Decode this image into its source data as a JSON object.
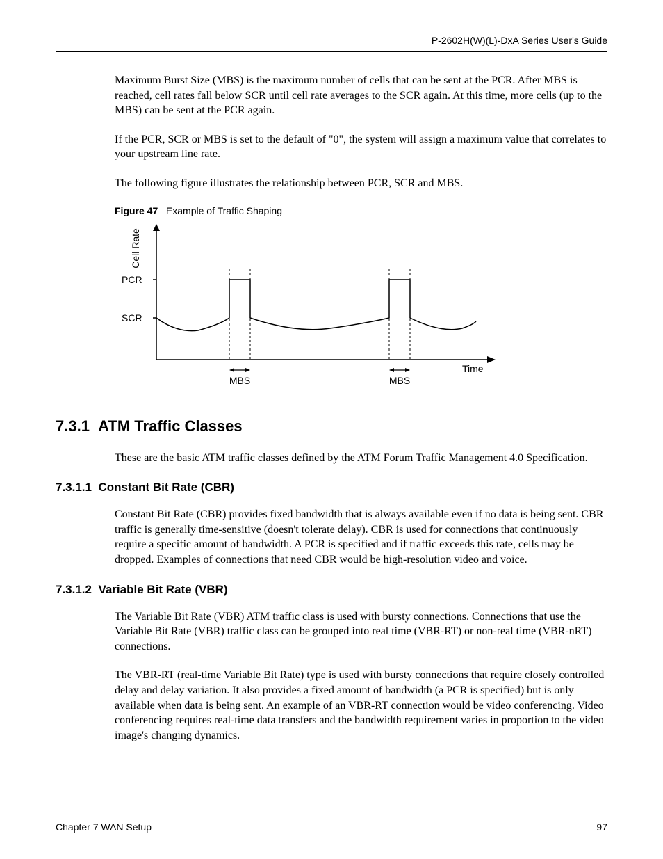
{
  "header": {
    "running": "P-2602H(W)(L)-DxA Series User's Guide"
  },
  "body": {
    "p1": "Maximum Burst Size (MBS) is the maximum number of cells that can be sent at the PCR. After MBS is reached, cell rates fall below SCR until cell rate averages to the SCR again. At this time, more cells (up to the MBS) can be sent at the PCR again.",
    "p2": "If the PCR, SCR or MBS is set to the default of \"0\", the system will assign a maximum value that correlates to your upstream line rate.",
    "p3": "The following figure illustrates the relationship between PCR, SCR and MBS."
  },
  "figure": {
    "label": "Figure 47",
    "caption": "Example of Traffic Shaping",
    "ylabel": "Cell Rate",
    "xlabel": "Time",
    "ytick1": "PCR",
    "ytick2": "SCR",
    "xannot1": "MBS",
    "xannot2": "MBS"
  },
  "sections": {
    "s1_num": "7.3.1",
    "s1_title": "ATM Traffic Classes",
    "s1_p1": "These are the basic ATM traffic classes defined by the ATM Forum Traffic Management 4.0 Specification.",
    "s11_num": "7.3.1.1",
    "s11_title": "Constant Bit Rate (CBR)",
    "s11_p1": "Constant Bit Rate (CBR) provides fixed bandwidth that is always available even if no data is being sent. CBR traffic is generally time-sensitive (doesn't tolerate delay). CBR is used for connections that continuously require a specific amount of bandwidth. A PCR is specified and if traffic exceeds this rate, cells may be dropped. Examples of connections that need CBR would be high-resolution video and voice.",
    "s12_num": "7.3.1.2",
    "s12_title": "Variable Bit Rate (VBR)",
    "s12_p1": "The Variable Bit Rate (VBR) ATM traffic class is used with bursty connections. Connections that use the Variable Bit Rate (VBR) traffic class can be grouped into real time (VBR-RT) or non-real time (VBR-nRT) connections.",
    "s12_p2": "The VBR-RT (real-time Variable Bit Rate) type is used with bursty connections that require closely controlled delay and delay variation. It also provides a fixed amount of bandwidth (a PCR is specified) but is only available when data is being sent. An example of an VBR-RT connection would be video conferencing. Video conferencing requires real-time data transfers and the bandwidth requirement varies in proportion to the video image's changing dynamics."
  },
  "footer": {
    "chapter": "Chapter 7 WAN Setup",
    "pagenum": "97"
  },
  "chart_data": {
    "type": "line",
    "title": "Example of Traffic Shaping",
    "xlabel": "Time",
    "ylabel": "Cell Rate",
    "y_levels": {
      "PCR": 1.0,
      "SCR": 0.55
    },
    "series": [
      {
        "name": "cell_rate",
        "x": [
          0.0,
          0.1,
          0.22,
          0.22,
          0.28,
          0.28,
          0.5,
          0.7,
          0.7,
          0.76,
          0.76,
          0.9,
          1.0
        ],
        "values": [
          0.55,
          0.4,
          0.55,
          1.0,
          1.0,
          0.55,
          0.4,
          0.55,
          1.0,
          1.0,
          0.55,
          0.4,
          0.55
        ]
      }
    ],
    "burst_intervals": [
      [
        0.22,
        0.28
      ],
      [
        0.7,
        0.76
      ]
    ],
    "annotations": [
      {
        "at_x": 0.25,
        "label": "MBS"
      },
      {
        "at_x": 0.73,
        "label": "MBS"
      }
    ]
  }
}
